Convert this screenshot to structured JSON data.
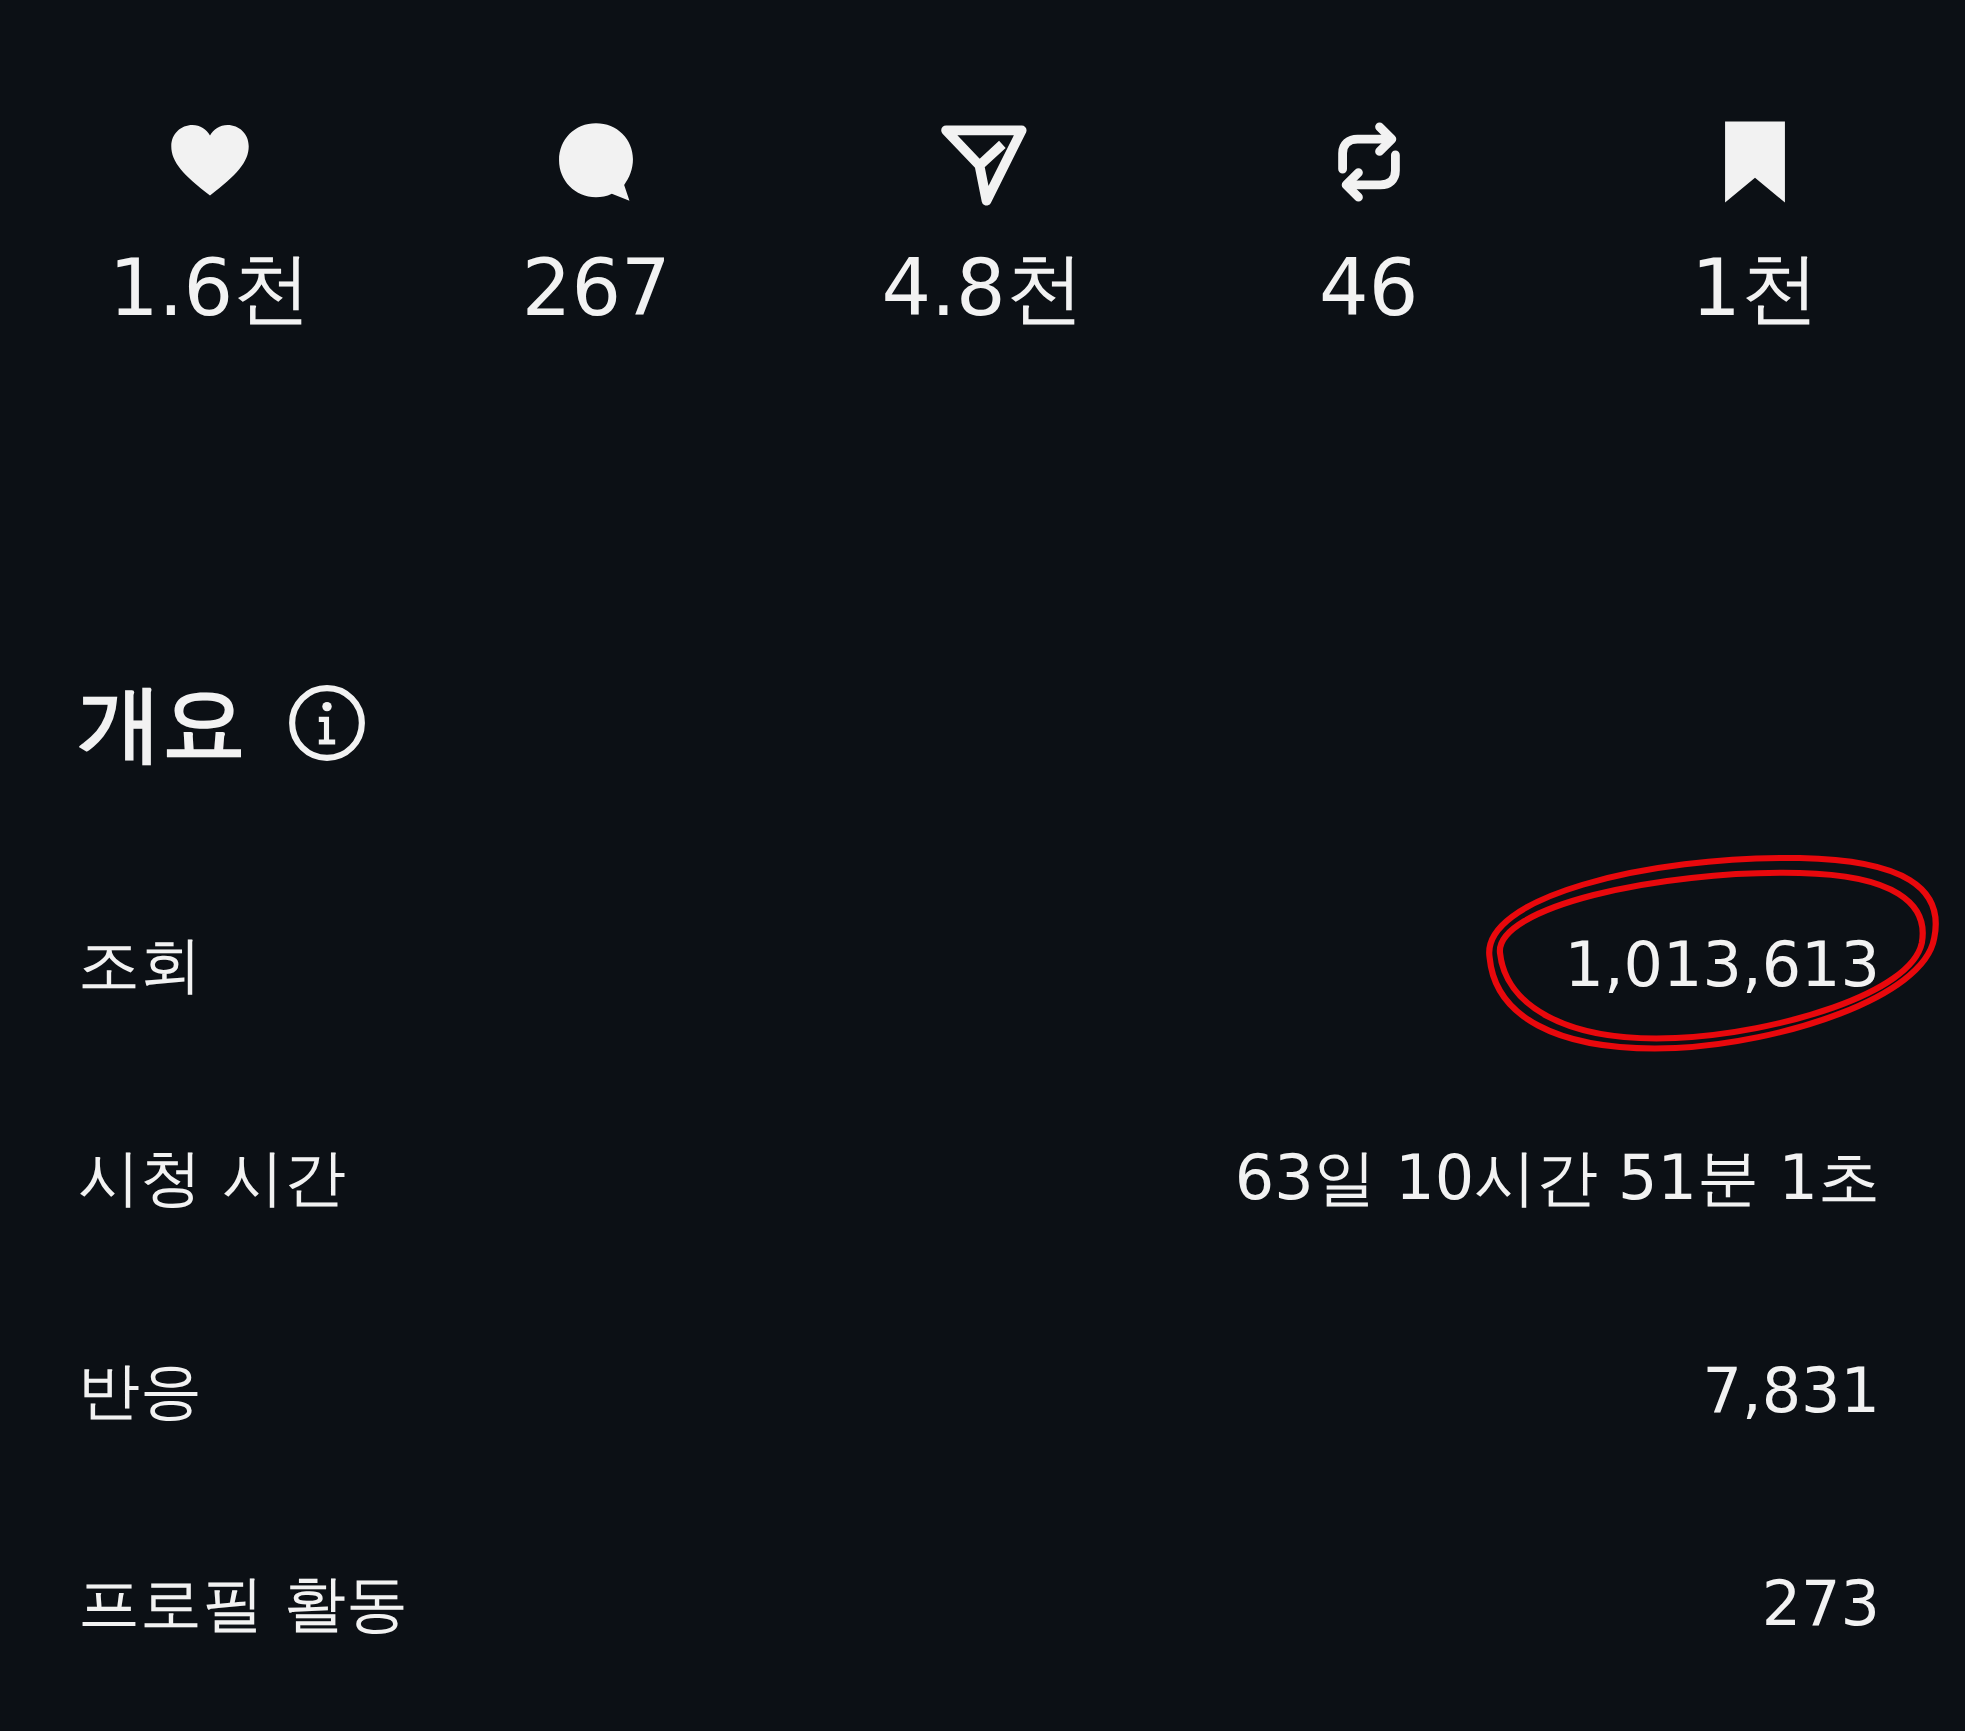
{
  "stats": [
    {
      "kind": "like",
      "count": "1.6천"
    },
    {
      "kind": "comment",
      "count": "267"
    },
    {
      "kind": "share",
      "count": "4.8천"
    },
    {
      "kind": "repost",
      "count": "46"
    },
    {
      "kind": "save",
      "count": "1천"
    }
  ],
  "overview": {
    "title": "개요",
    "rows": [
      {
        "label": "조회",
        "value": "1,013,613",
        "highlighted": true
      },
      {
        "label": "시청 시간",
        "value": "63일 10시간 51분 1초",
        "highlighted": false
      },
      {
        "label": "반응",
        "value": "7,831",
        "highlighted": false
      },
      {
        "label": "프로필 활동",
        "value": "273",
        "highlighted": false
      }
    ]
  }
}
